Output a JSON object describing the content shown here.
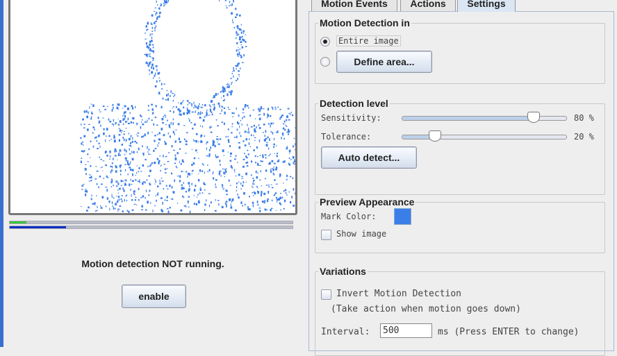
{
  "left": {
    "status_text": "Motion detection NOT running.",
    "enable_label": "enable",
    "activity_level_percent": 6,
    "threshold_percent": 20
  },
  "tabs": [
    {
      "label": "Motion Events"
    },
    {
      "label": "Actions"
    },
    {
      "label": "Settings",
      "active": true
    }
  ],
  "settings": {
    "motion_detection_in": {
      "title": "Motion Detection in",
      "entire_image_label": "Entire image",
      "define_area_label": "Define area...",
      "selected": "Entire image"
    },
    "detection_level": {
      "title": "Detection level",
      "sensitivity_label": "Sensitivity:",
      "sensitivity_value": 80,
      "sensitivity_text": "80 %",
      "tolerance_label": "Tolerance:",
      "tolerance_value": 20,
      "tolerance_text": "20 %",
      "auto_detect_label": "Auto detect..."
    },
    "preview_appearance": {
      "title": "Preview Appearance",
      "mark_color_label": "Mark Color:",
      "mark_color": "#3b7ee8",
      "show_image_label": "Show image",
      "show_image_checked": false
    },
    "variations": {
      "title": "Variations",
      "invert_label": "Invert Motion Detection",
      "invert_checked": false,
      "invert_hint": "(Take action when motion goes down)",
      "interval_label": "Interval:",
      "interval_value": "500",
      "interval_hint": "ms (Press ENTER to change)"
    }
  }
}
